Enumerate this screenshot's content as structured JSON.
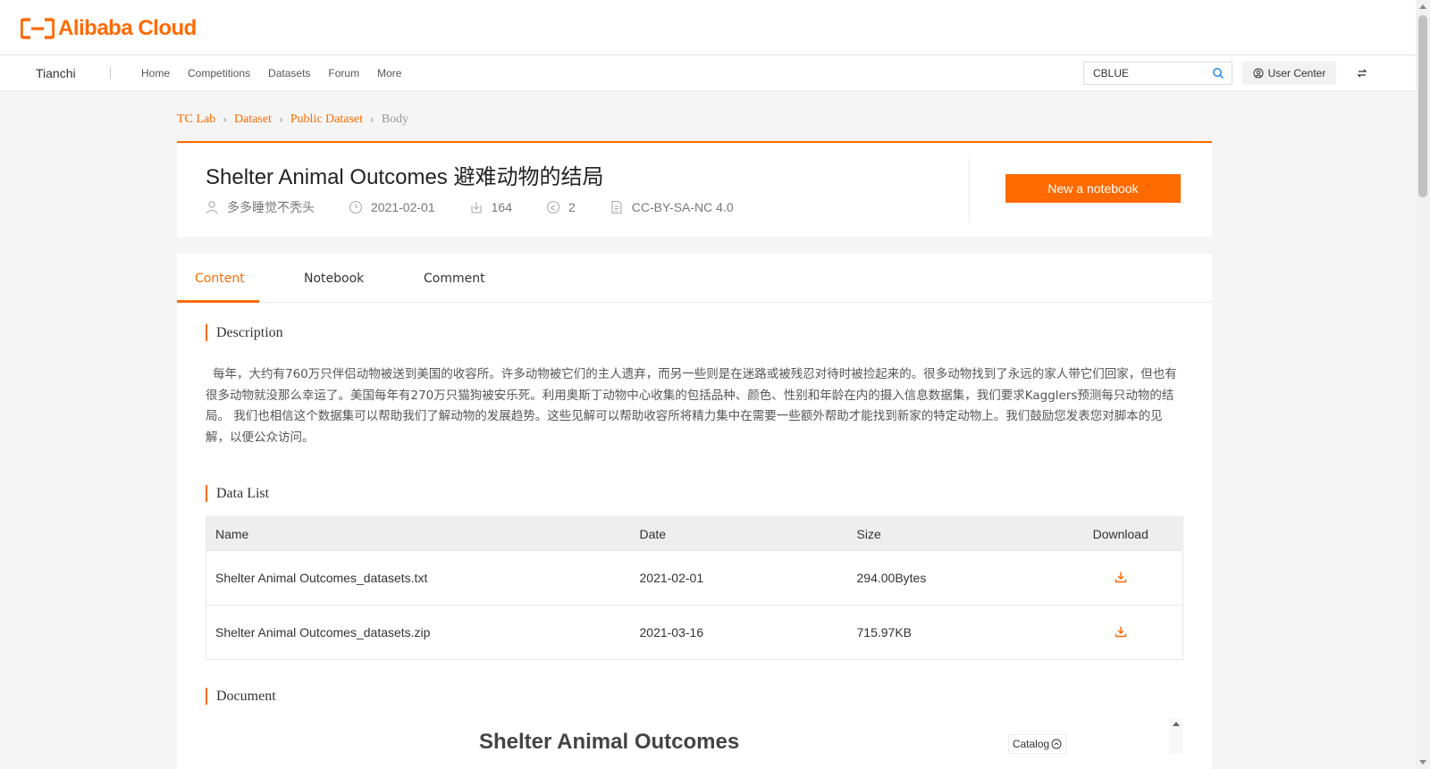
{
  "brand": {
    "logo_text": "Alibaba Cloud",
    "accent": "#ff6a00"
  },
  "nav": {
    "brand": "Tianchi",
    "links": [
      "Home",
      "Competitions",
      "Datasets",
      "Forum",
      "More"
    ],
    "search_value": "CBLUE",
    "user_center": "User Center"
  },
  "breadcrumb": [
    "TC Lab",
    "Dataset",
    "Public Dataset",
    "Body"
  ],
  "dataset": {
    "title": "Shelter Animal Outcomes 避难动物的结局",
    "author": "多多睡觉不秃头",
    "date": "2021-02-01",
    "downloads": "164",
    "shares": "2",
    "license": "CC-BY-SA-NC 4.0",
    "new_notebook": "New a notebook"
  },
  "tabs": [
    "Content",
    "Notebook",
    "Comment"
  ],
  "sections": {
    "description_title": "Description",
    "description_text": "每年，大约有760万只伴侣动物被送到美国的收容所。许多动物被它们的主人遗弃，而另一些则是在迷路或被残忍对待时被捡起来的。很多动物找到了永远的家人带它们回家，但也有很多动物就没那么幸运了。美国每年有270万只猫狗被安乐死。利用奥斯丁动物中心收集的包括品种、颜色、性别和年龄在内的摄入信息数据集，我们要求Kagglers预测每只动物的结局。 我们也相信这个数据集可以帮助我们了解动物的发展趋势。这些见解可以帮助收容所将精力集中在需要一些额外帮助才能找到新家的特定动物上。我们鼓励您发表您对脚本的见解，以便公众访问。",
    "data_list_title": "Data List",
    "document_title": "Document"
  },
  "table": {
    "headers": {
      "name": "Name",
      "date": "Date",
      "size": "Size",
      "download": "Download"
    },
    "rows": [
      {
        "name": "Shelter Animal Outcomes_datasets.txt",
        "date": "2021-02-01",
        "size": "294.00Bytes"
      },
      {
        "name": "Shelter Animal Outcomes_datasets.zip",
        "date": "2021-03-16",
        "size": "715.97KB"
      }
    ]
  },
  "document": {
    "heading": "Shelter Animal Outcomes",
    "catalog": "Catalog"
  }
}
